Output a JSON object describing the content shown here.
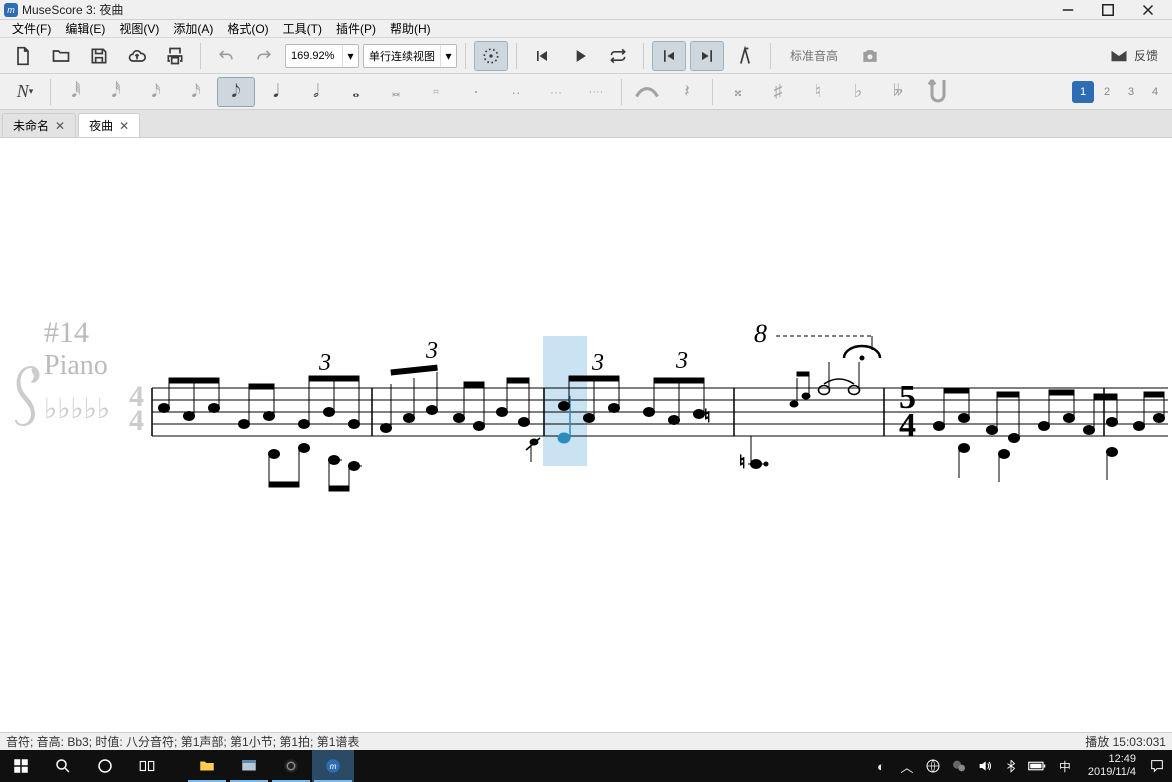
{
  "window": {
    "title": "MuseScore 3: 夜曲"
  },
  "menu": {
    "file": "文件(F)",
    "edit": "编辑(E)",
    "view": "视图(V)",
    "add": "添加(A)",
    "format": "格式(O)",
    "tools": "工具(T)",
    "plugins": "插件(P)",
    "help": "帮助(H)"
  },
  "toolbar": {
    "zoom_value": "169.92%",
    "view_mode": "单行连续视图",
    "pitch_placeholder": "标准音高"
  },
  "feedback_label": "反馈",
  "voices": {
    "v1": "1",
    "v2": "2",
    "v3": "3",
    "v4": "4"
  },
  "tabs": [
    {
      "label": "未命名",
      "active": false
    },
    {
      "label": "夜曲",
      "active": true
    }
  ],
  "score": {
    "system_index": "#14",
    "instrument": "Piano",
    "time_sig_upper": "5",
    "time_sig_lower": "4",
    "ottava": "8",
    "tuplet_marks": [
      "3",
      "3",
      "3",
      "3"
    ]
  },
  "status": {
    "left": "音符; 音高: Bb3; 时值: 八分音符; 第1声部; 第1小节; 第1拍; 第1谱表",
    "right": "播放  15:03:031"
  },
  "taskbar": {
    "ime": "中",
    "time": "12:49",
    "date": "2019/11/4"
  }
}
